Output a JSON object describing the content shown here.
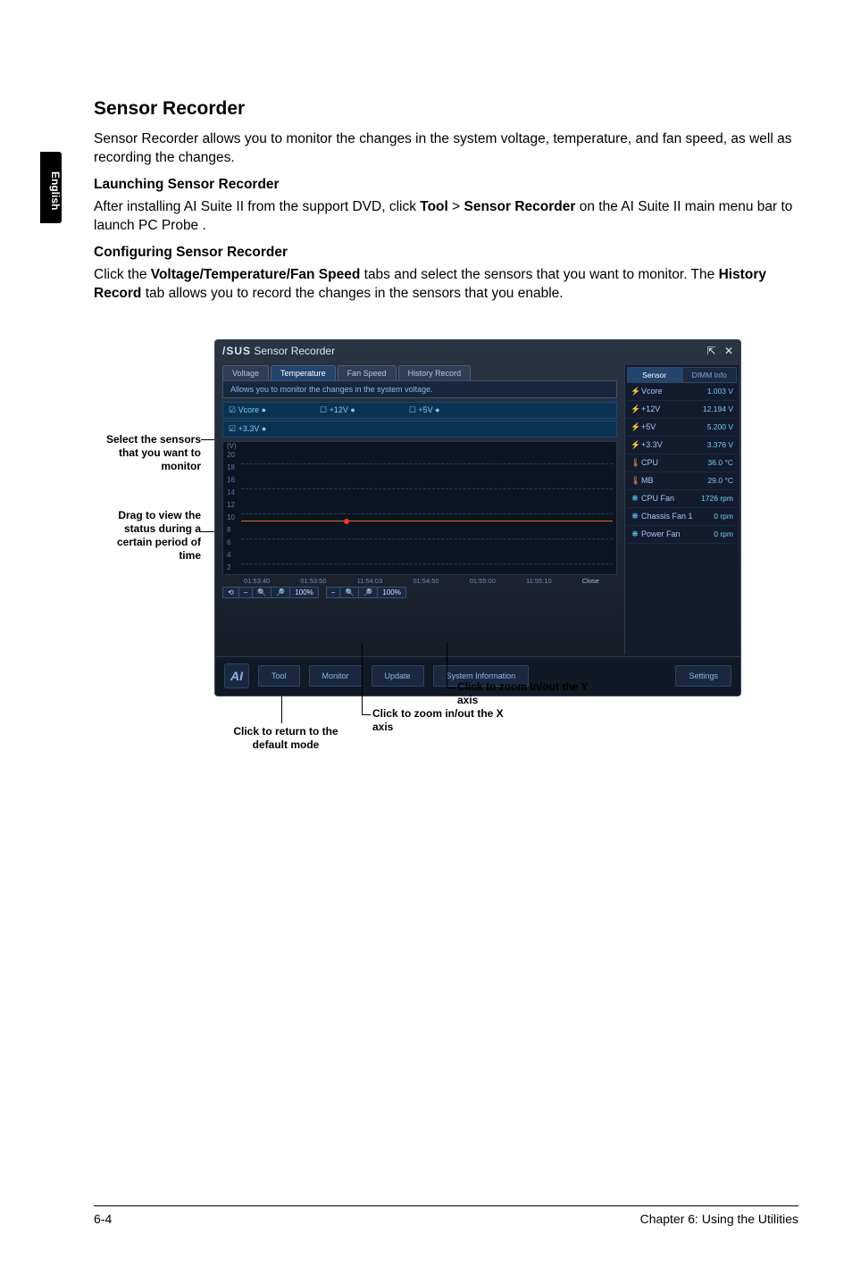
{
  "sideTab": "English",
  "heading": "Sensor Recorder",
  "intro": "Sensor Recorder allows you to monitor the changes in the system voltage, temperature, and fan speed, as well as recording the changes.",
  "launchHeading": "Launching Sensor Recorder",
  "launchText1": "After installing AI Suite II from the support DVD, click ",
  "launchBold1": "Tool",
  "launchGt": " > ",
  "launchBold2": "Sensor Recorder",
  "launchText2": " on the AI Suite II main menu bar to launch PC Probe .",
  "configHeading": "Configuring Sensor Recorder",
  "configText1": "Click the ",
  "configBold1": "Voltage/Temperature/Fan Speed",
  "configText2": " tabs and select the sensors that you want to monitor. The ",
  "configBold2": "History Record",
  "configText3": " tab allows you to record the changes in the sensors that you enable.",
  "callouts": {
    "select": "Select the sensors that you want to monitor",
    "drag": "Drag to view the status during a certain period of time",
    "returnDefault": "Click to return to the default mode",
    "zoomX": "Click to zoom in/out the X axis",
    "zoomY": "Click to zoom in/out the Y axis"
  },
  "app": {
    "brand": "/SUS",
    "title": "Sensor Recorder",
    "winMin": "▬",
    "winPin": "⇱",
    "winClose": "✕",
    "tabs": {
      "voltage": "Voltage",
      "temperature": "Temperature",
      "fanSpeed": "Fan Speed",
      "historyRecord": "History Record"
    },
    "desc": "Allows you to monitor the changes in the system voltage.",
    "checks": {
      "vcore": "Vcore ●",
      "p12v": "+12V ●",
      "p5v": "+5V ●",
      "p33v": "+3.3V ●"
    },
    "chart": {
      "yLabels": [
        "(V)",
        "20",
        "18",
        "16",
        "14",
        "12",
        "10",
        "8",
        "6",
        "4",
        "2"
      ],
      "xLabels": [
        "01:53:40",
        "01:53:50",
        "11:54:03",
        "01:54:50",
        "01:55:00",
        "11:55:10"
      ],
      "close": "Close",
      "zoomX": [
        "⟲",
        "−",
        "🔍",
        "🔎",
        "100%"
      ],
      "zoomY": [
        "−",
        "🔍",
        "🔎",
        "100%"
      ]
    },
    "bottom": {
      "logo": "AI",
      "tool": "Tool",
      "monitor": "Monitor",
      "update": "Update",
      "sysinfo": "System Information",
      "settings": "Settings"
    },
    "side": {
      "tabSensor": "Sensor",
      "tabDimm": "DIMM Info",
      "rows": [
        {
          "ic": "⚡",
          "cls": "ic-bolt",
          "lab": "Vcore",
          "val": "1.003 V"
        },
        {
          "ic": "⚡",
          "cls": "ic-bolt",
          "lab": "+12V",
          "val": "12.194 V"
        },
        {
          "ic": "⚡",
          "cls": "ic-bolt",
          "lab": "+5V",
          "val": "5.200 V"
        },
        {
          "ic": "⚡",
          "cls": "ic-bolt",
          "lab": "+3.3V",
          "val": "3.376 V"
        },
        {
          "ic": "🌡",
          "cls": "ic-temp",
          "lab": "CPU",
          "val": "36.0 °C"
        },
        {
          "ic": "🌡",
          "cls": "ic-temp",
          "lab": "MB",
          "val": "29.0 °C"
        },
        {
          "ic": "❋",
          "cls": "ic-fan",
          "lab": "CPU Fan",
          "val": "1726 rpm"
        },
        {
          "ic": "❋",
          "cls": "ic-fan",
          "lab": "Chassis Fan 1",
          "val": "0 rpm"
        },
        {
          "ic": "❋",
          "cls": "ic-fan",
          "lab": "Power Fan",
          "val": "0 rpm"
        }
      ]
    }
  },
  "footer": {
    "left": "6-4",
    "right": "Chapter 6: Using the Utilities"
  }
}
